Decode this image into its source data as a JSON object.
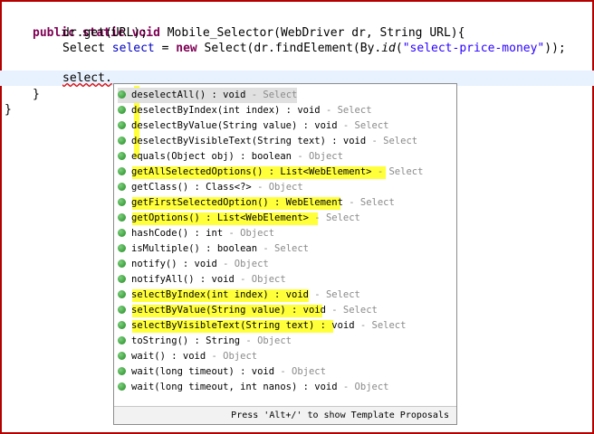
{
  "editor": {
    "line1": {
      "kw1": "public",
      "kw2": "static",
      "kw3": "void",
      "text": " Mobile_Selector(WebDriver dr, String URL){"
    },
    "line2": {
      "text": "dr.get(URL);"
    },
    "line3": {
      "pre": "Select ",
      "var": "select",
      "mid": " = ",
      "kw": "new",
      "mid2": " Select(dr.findElement(By.",
      "method": "id",
      "open": "(",
      "str": "\"select-price-money\"",
      "close": "));"
    },
    "line4": {
      "text": "select."
    },
    "line5": {
      "text": "}"
    },
    "line6": {
      "text": "}"
    }
  },
  "autocomplete": {
    "items": [
      {
        "name": "deselectAll() : void",
        "owner": "Select"
      },
      {
        "name": "deselectByIndex(int index) : void",
        "owner": "Select"
      },
      {
        "name": "deselectByValue(String value) : void",
        "owner": "Select"
      },
      {
        "name": "deselectByVisibleText(String text) : void",
        "owner": "Select"
      },
      {
        "name": "equals(Object obj) : boolean",
        "owner": "Object"
      },
      {
        "name": "getAllSelectedOptions() : List<WebElement>",
        "owner": "Select"
      },
      {
        "name": "getClass() : Class<?>",
        "owner": "Object"
      },
      {
        "name": "getFirstSelectedOption() : WebElement",
        "owner": "Select"
      },
      {
        "name": "getOptions() : List<WebElement>",
        "owner": "Select"
      },
      {
        "name": "hashCode() : int",
        "owner": "Object"
      },
      {
        "name": "isMultiple() : boolean",
        "owner": "Select"
      },
      {
        "name": "notify() : void",
        "owner": "Object"
      },
      {
        "name": "notifyAll() : void",
        "owner": "Object"
      },
      {
        "name": "selectByIndex(int index) : void",
        "owner": "Select"
      },
      {
        "name": "selectByValue(String value) : void",
        "owner": "Select"
      },
      {
        "name": "selectByVisibleText(String text) : void",
        "owner": "Select"
      },
      {
        "name": "toString() : String",
        "owner": "Object"
      },
      {
        "name": "wait() : void",
        "owner": "Object"
      },
      {
        "name": "wait(long timeout) : void",
        "owner": "Object"
      },
      {
        "name": "wait(long timeout, int nanos) : void",
        "owner": "Object"
      }
    ],
    "separator": " - ",
    "status_text": "Press 'Alt+/' to show Template Proposals"
  },
  "colors": {
    "highlight": "#ffff3a",
    "keyword": "#7f0055",
    "field": "#0000c0",
    "string": "#2a00ff",
    "frame": "#b30000"
  }
}
